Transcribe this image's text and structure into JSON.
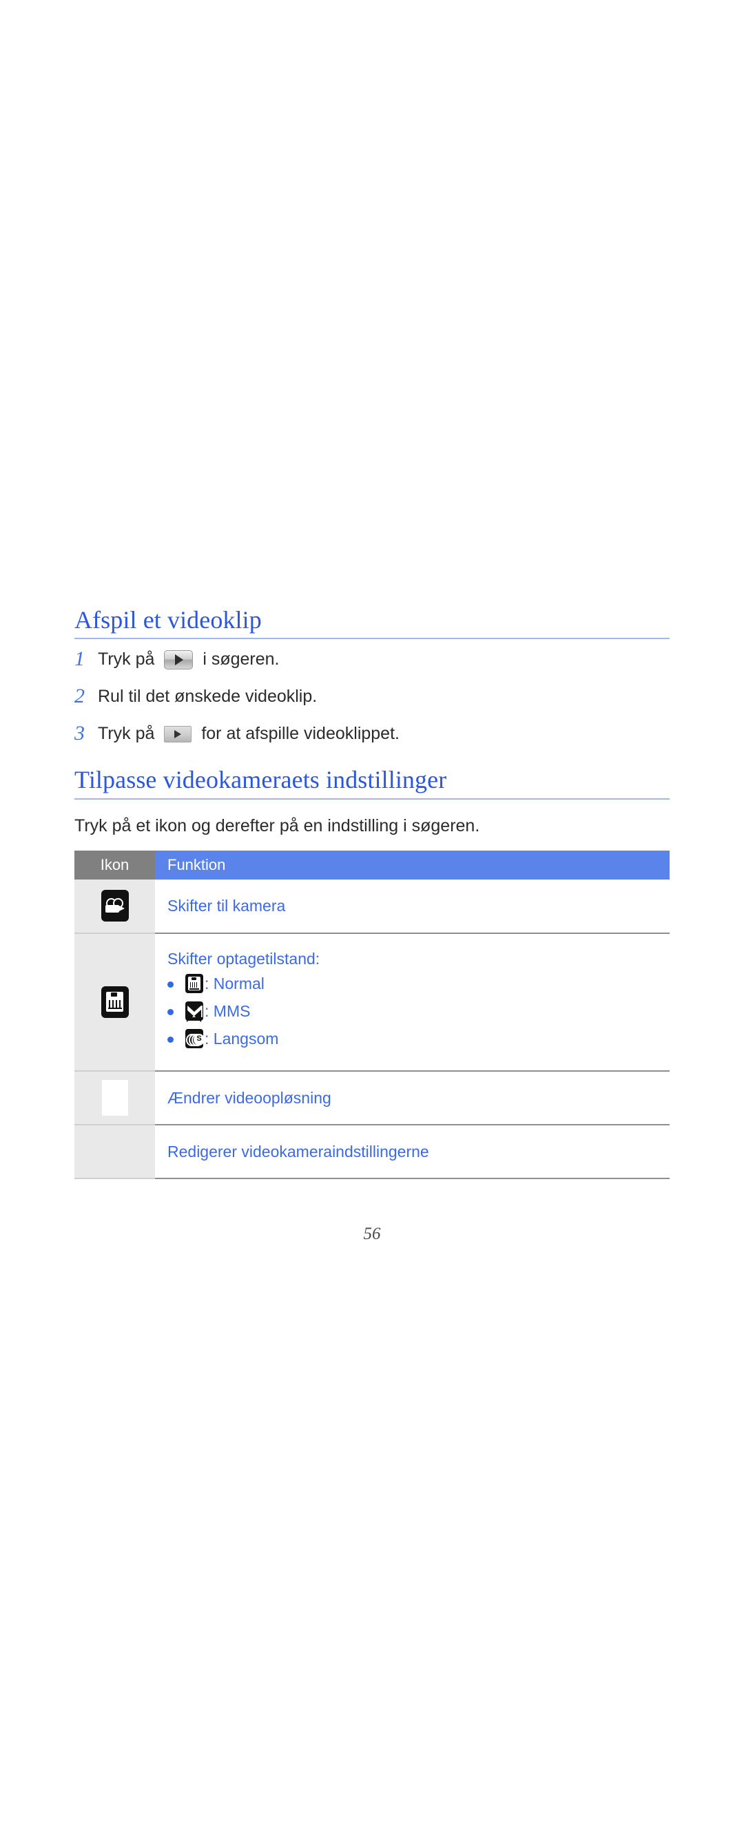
{
  "document": {
    "page_number": "56"
  },
  "sections": [
    {
      "heading": "Afspil et videoklip",
      "steps": [
        {
          "number": "1",
          "text_before": "Tryk på ",
          "icon": "play-button-icon",
          "text_after": " i søgeren."
        },
        {
          "number": "2",
          "text_before": "Rul til det ønskede videoklip.",
          "icon": "",
          "text_after": ""
        },
        {
          "number": "3",
          "text_before": "Tryk på ",
          "icon": "play-button-icon",
          "text_after": " for at afspille videoklippet."
        }
      ]
    },
    {
      "heading": "Tilpasse videokameraets indstillinger",
      "intro": "Tryk på et ikon og derefter på en indstilling i søgeren."
    }
  ],
  "table": {
    "headers": {
      "icon": "Ikon",
      "function": "Funktion"
    },
    "rows": [
      {
        "icon_name": "camcorder-icon",
        "function": "Skifter til kamera",
        "bullets": []
      },
      {
        "icon_name": "recording-mode-icon",
        "function": "Skifter optagetilstand:",
        "bullets": [
          {
            "icon_name": "normal-mode-icon",
            "label": ": Normal"
          },
          {
            "icon_name": "mms-mode-icon",
            "label": ": MMS"
          },
          {
            "icon_name": "slow-mode-icon",
            "label": ": Langsom"
          }
        ]
      },
      {
        "icon_name": "video-resolution-icon",
        "function": "Ændrer videoopløsning",
        "bullets": []
      },
      {
        "icon_name": "settings-icon",
        "function": "Redigerer videokameraindstillingerne",
        "bullets": []
      }
    ]
  },
  "colors": {
    "heading_blue": "#2a56e0",
    "link_blue": "#3a6ae8",
    "header_blue": "#5b84ea",
    "header_gray": "#808080",
    "icon_cell_gray": "#e9e9e9",
    "body_text": "#2b2b2b"
  }
}
